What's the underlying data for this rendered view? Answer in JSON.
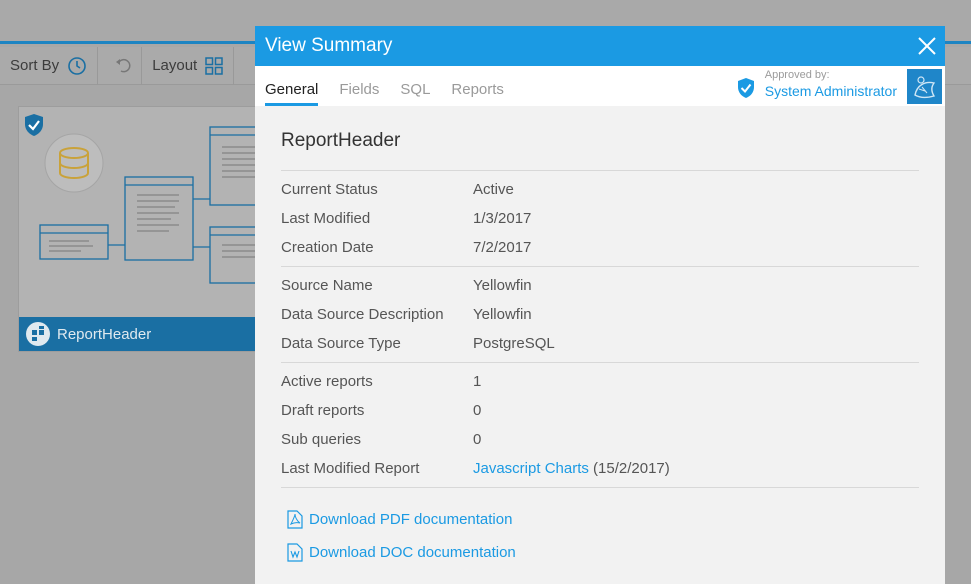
{
  "toolbar": {
    "sort_label": "Sort By",
    "layout_label": "Layout"
  },
  "card": {
    "name": "ReportHeader"
  },
  "modal": {
    "title": "View Summary",
    "tabs": [
      "General",
      "Fields",
      "SQL",
      "Reports"
    ],
    "approval": {
      "label": "Approved by:",
      "name": "System Administrator"
    },
    "report_name": "ReportHeader",
    "group1": [
      {
        "k": "Current Status",
        "v": "Active"
      },
      {
        "k": "Last Modified",
        "v": "1/3/2017"
      },
      {
        "k": "Creation Date",
        "v": "7/2/2017"
      }
    ],
    "group2": [
      {
        "k": "Source Name",
        "v": "Yellowfin"
      },
      {
        "k": "Data Source Description",
        "v": "Yellowfin"
      },
      {
        "k": "Data Source Type",
        "v": "PostgreSQL"
      }
    ],
    "group3": [
      {
        "k": "Active reports",
        "v": "1"
      },
      {
        "k": "Draft reports",
        "v": "0"
      },
      {
        "k": "Sub queries",
        "v": "0"
      }
    ],
    "last_modified_report": {
      "k": "Last Modified Report",
      "link": "Javascript Charts",
      "date": "(15/2/2017)"
    },
    "downloads": {
      "pdf": "Download PDF documentation",
      "doc": "Download DOC documentation"
    }
  },
  "colors": {
    "accent": "#1b9ae3",
    "card_footer": "#1a6fa3"
  }
}
